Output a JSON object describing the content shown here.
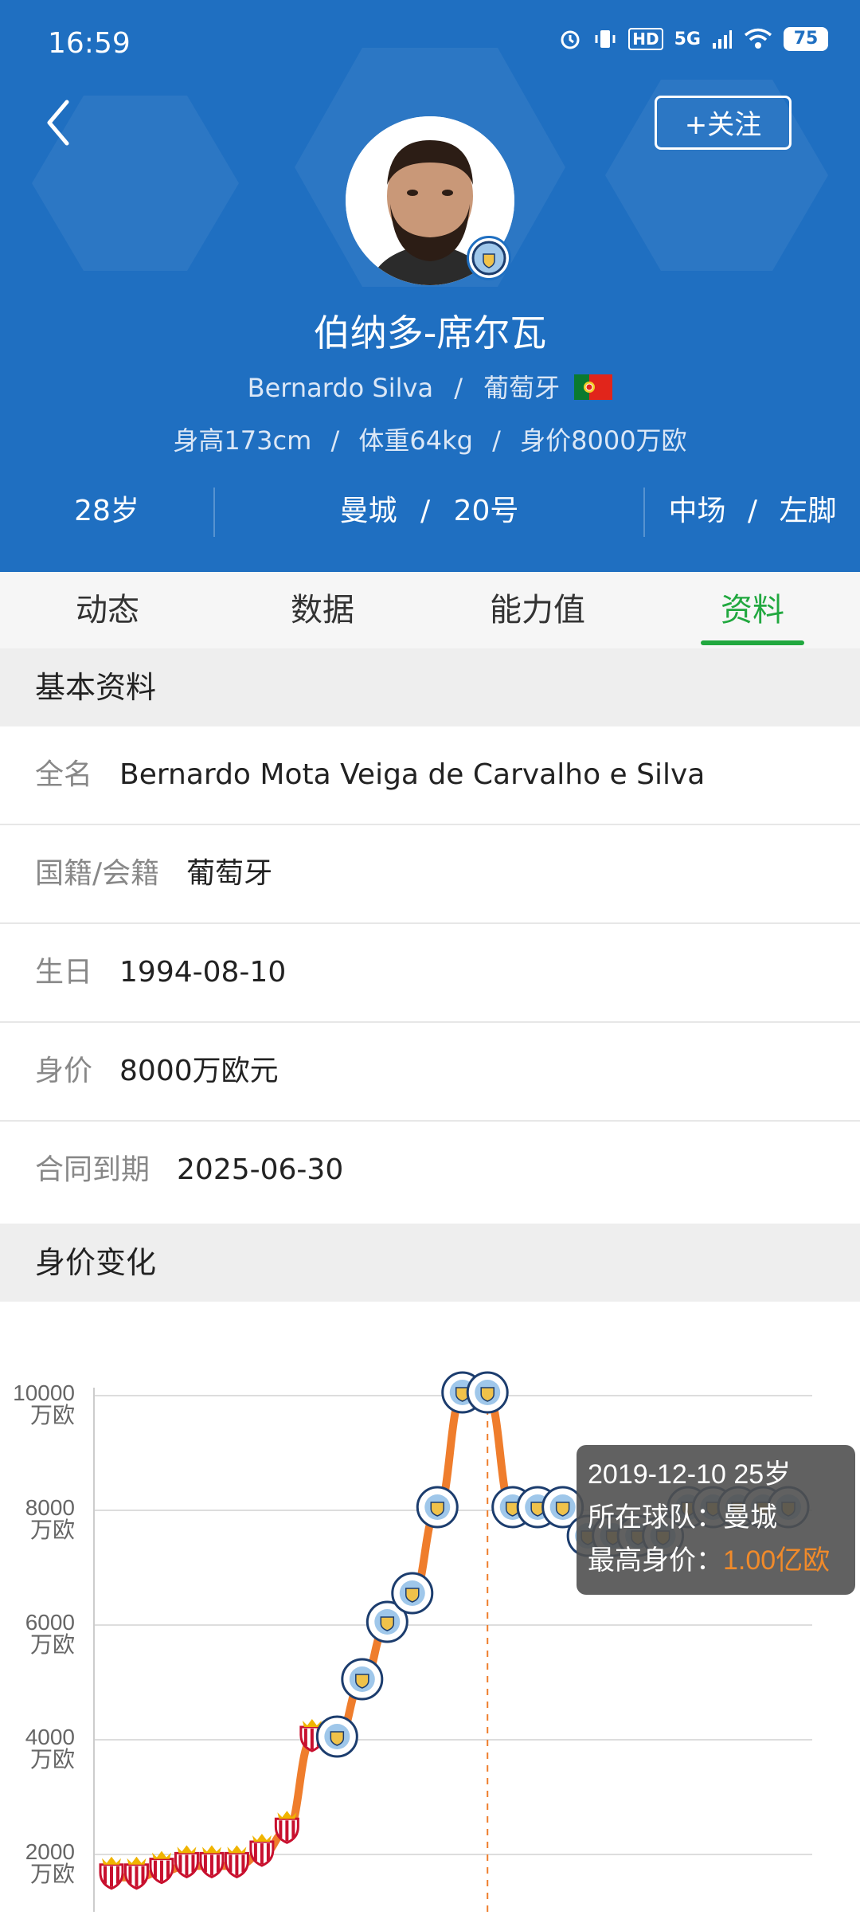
{
  "status_bar": {
    "time": "16:59",
    "network": "5G",
    "hd_label": "HD",
    "battery": "75"
  },
  "header": {
    "follow_label": "+关注",
    "name_cn": "伯纳多-席尔瓦",
    "name_en": "Bernardo  Silva",
    "nationality": "葡萄牙",
    "height": "身高173cm",
    "weight": "体重64kg",
    "value": "身价8000万欧",
    "age": "28岁",
    "club": "曼城",
    "number": "20号",
    "position": "中场",
    "foot": "左脚",
    "sep": "/",
    "bg_color": "#1f6fc1"
  },
  "tabs": [
    {
      "label": "动态",
      "active": false
    },
    {
      "label": "数据",
      "active": false
    },
    {
      "label": "能力值",
      "active": false
    },
    {
      "label": "资料",
      "active": true
    }
  ],
  "basic_info": {
    "title": "基本资料",
    "rows": [
      {
        "label": "全名",
        "value": "Bernardo Mota Veiga de Carvalho e Silva"
      },
      {
        "label": "国籍/会籍",
        "value": "葡萄牙"
      },
      {
        "label": "生日",
        "value": "1994-08-10"
      },
      {
        "label": "身价",
        "value": "8000万欧元"
      },
      {
        "label": "合同到期",
        "value": "2025-06-30"
      }
    ]
  },
  "value_section": {
    "title": "身价变化"
  },
  "chart_data": {
    "type": "line",
    "title": "",
    "xlabel": "",
    "ylabel": "",
    "ylim": [
      0,
      10000
    ],
    "y_ticks": [
      {
        "value": 10000,
        "label": "10000",
        "unit": "万欧"
      },
      {
        "value": 8000,
        "label": "8000",
        "unit": "万欧"
      },
      {
        "value": 6000,
        "label": "6000",
        "unit": "万欧"
      },
      {
        "value": 4000,
        "label": "4000",
        "unit": "万欧"
      },
      {
        "value": 2000,
        "label": "2000",
        "unit": "万欧"
      }
    ],
    "x": [
      0,
      1,
      2,
      3,
      4,
      5,
      6,
      7,
      8,
      9,
      10,
      11,
      12,
      13,
      14,
      15,
      16,
      17,
      18,
      19,
      20,
      21,
      22,
      23,
      24,
      25,
      26,
      27
    ],
    "series": [
      {
        "values": [
          1600,
          1600,
          1700,
          1800,
          1800,
          1800,
          2000,
          2400,
          4000,
          4000,
          5000,
          6000,
          6500,
          8000,
          10000,
          10000,
          8000,
          8000,
          8000,
          7500,
          7500,
          7500,
          7500,
          8000,
          8000,
          8000,
          8000,
          8000
        ],
        "clubs": [
          "monaco",
          "monaco",
          "monaco",
          "monaco",
          "monaco",
          "monaco",
          "monaco",
          "monaco",
          "monaco",
          "city",
          "city",
          "city",
          "city",
          "city",
          "city",
          "city",
          "city",
          "city",
          "city",
          "city",
          "city",
          "city",
          "city",
          "city",
          "city",
          "city",
          "city",
          "city"
        ]
      }
    ],
    "line_color": "#ef7d2c",
    "highlight_index": 15,
    "tooltip": {
      "date": "2019-12-10",
      "age": "25岁",
      "team_label": "所在球队：",
      "team": "曼城",
      "value_label": "最高身价：",
      "value": "1.00亿欧",
      "value_color": "#f08a2a"
    }
  }
}
